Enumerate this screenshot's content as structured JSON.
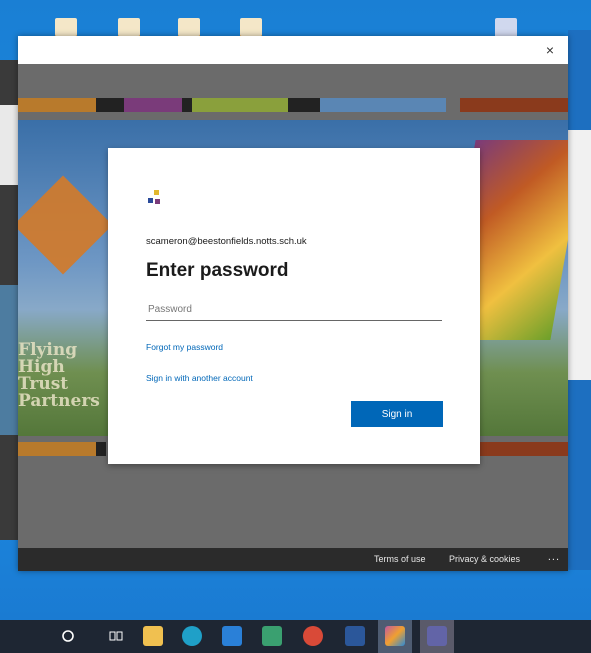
{
  "account": {
    "email": "scameron@beestonfields.notts.sch.uk"
  },
  "card": {
    "title": "Enter password",
    "password_placeholder": "Password",
    "forgot_label": "Forgot my password",
    "other_account_label": "Sign in with another account",
    "signin_label": "Sign in"
  },
  "window": {
    "close_label": "×"
  },
  "banner": {
    "trust_text": [
      "Flying",
      "High",
      "Trust",
      "Partners"
    ]
  },
  "footer": {
    "terms_label": "Terms of use",
    "privacy_label": "Privacy & cookies",
    "more_label": "..."
  },
  "taskbar": {
    "items": [
      "search-circle-icon",
      "task-view-icon",
      "store-icon",
      "edge-icon",
      "mail-icon",
      "photos-icon",
      "chrome-icon",
      "word-icon",
      "kite-app-icon",
      "teams-icon"
    ]
  },
  "colors": {
    "accent": "#0067b8",
    "desktop": "#1b84d8",
    "taskbar": "#1e2633"
  }
}
